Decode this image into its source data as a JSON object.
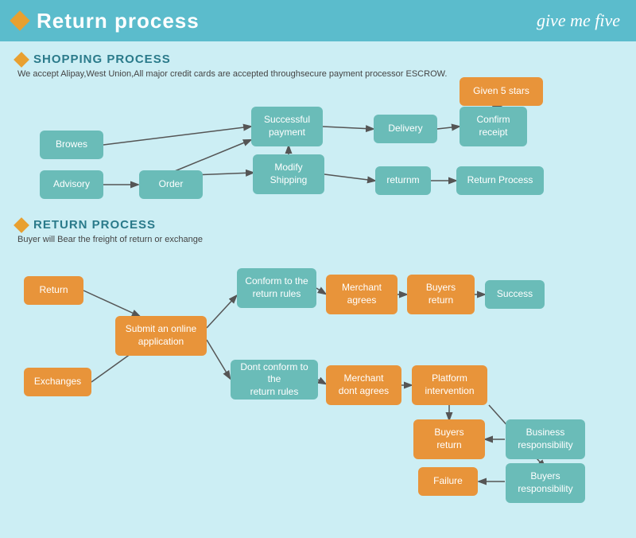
{
  "header": {
    "title": "Return process",
    "logo": "give me five"
  },
  "shopping": {
    "section_title": "SHOPPING PROCESS",
    "subtitle": "We accept Alipay,West Union,All major credit cards are accepted throughsecure payment processor ESCROW.",
    "boxes": {
      "browes": "Browes",
      "order": "Order",
      "advisory": "Advisory",
      "modify_shipping": "Modify\nShipping",
      "successful_payment": "Successful\npayment",
      "delivery": "Delivery",
      "confirm_receipt": "Confirm\nreceipt",
      "given_5_stars": "Given 5 stars",
      "returnm": "returnm",
      "return_process": "Return Process"
    }
  },
  "return": {
    "section_title": "RETURN PROCESS",
    "subtitle": "Buyer will Bear the freight of return or exchange",
    "boxes": {
      "return": "Return",
      "submit_online": "Submit an online\napplication",
      "exchanges": "Exchanges",
      "conform_rules": "Conform to the\nreturn rules",
      "merchant_agrees": "Merchant\nagrees",
      "buyers_return1": "Buyers\nreturn",
      "success": "Success",
      "dont_conform": "Dont conform to the\nreturn rules",
      "merchant_dont": "Merchant\ndont agrees",
      "platform_intervention": "Platform\nintervention",
      "buyers_return2": "Buyers\nreturn",
      "business_responsibility": "Business\nresponsibility",
      "failure": "Failure",
      "buyers_responsibility": "Buyers\nresponsibility"
    }
  }
}
